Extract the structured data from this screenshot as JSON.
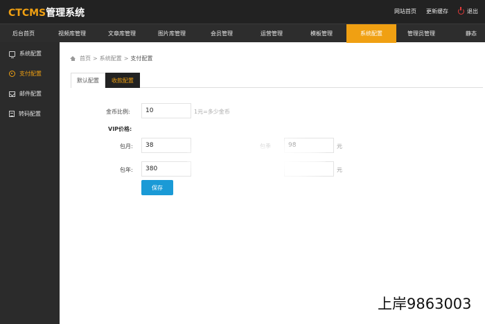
{
  "header": {
    "logo_brand": "CTCMS",
    "logo_suffix": "管理系统",
    "links": {
      "site_home": "网站首页",
      "update_cache": "更新缓存",
      "logout": "退出"
    }
  },
  "nav": {
    "items": [
      "后台首页",
      "视频库管理",
      "文章库管理",
      "图片库管理",
      "会员管理",
      "运营管理",
      "模板管理",
      "系统配置",
      "管理员管理",
      "静态"
    ],
    "active": "系统配置"
  },
  "sidebar": {
    "items": [
      "系统配置",
      "支付配置",
      "邮件配置",
      "转码配置"
    ],
    "active": "支付配置"
  },
  "breadcrumb": {
    "home": "首页",
    "sep1": ">",
    "parent": "系统配置",
    "sep2": ">",
    "current": "支付配置"
  },
  "tabs": {
    "default": "默认配置",
    "payment": "收款配置"
  },
  "form": {
    "coin_ratio_label": "金币比例:",
    "coin_ratio_value": "10",
    "coin_ratio_hint": "1元=多少金币",
    "vip_title": "VIP价格:",
    "monthly_label": "包月:",
    "monthly_value": "38",
    "quarterly_label": "包季",
    "quarterly_value": "98",
    "quarterly_unit": "元",
    "yearly_label": "包年:",
    "yearly_value": "380",
    "yearly_unit": "元",
    "save_label": "保存"
  },
  "watermark": "上岸9863003",
  "colors": {
    "accent": "#f0a012",
    "header_bg": "#222222",
    "button": "#1a9ad6"
  }
}
